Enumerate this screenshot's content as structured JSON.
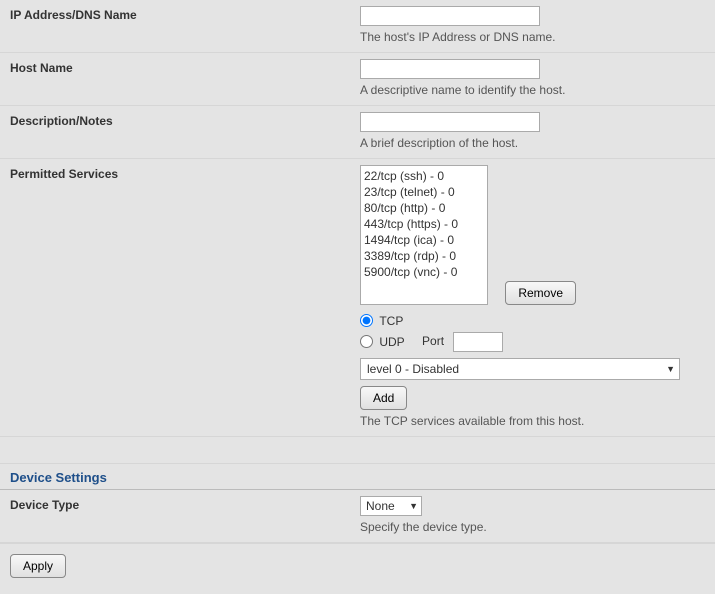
{
  "fields": {
    "ip": {
      "label": "IP Address/DNS Name",
      "value": "",
      "helper": "The host's IP Address or DNS name."
    },
    "hostname": {
      "label": "Host Name",
      "value": "",
      "helper": "A descriptive name to identify the host."
    },
    "description": {
      "label": "Description/Notes",
      "value": "",
      "helper": "A brief description of the host."
    },
    "services": {
      "label": "Permitted Services",
      "list": [
        "22/tcp (ssh) - 0",
        "23/tcp (telnet) - 0",
        "80/tcp (http) - 0",
        "443/tcp (https) - 0",
        "1494/tcp (ica) - 0",
        "3389/tcp (rdp) - 0",
        "5900/tcp (vnc) - 0"
      ],
      "remove_label": "Remove",
      "tcp_label": "TCP",
      "udp_label": "UDP",
      "port_label": "Port",
      "port_value": "",
      "level_selected": "level 0 - Disabled",
      "add_label": "Add",
      "helper": "The TCP services available from this host."
    }
  },
  "device_section": {
    "header": "Device Settings",
    "type_label": "Device Type",
    "type_selected": "None",
    "helper": "Specify the device type."
  },
  "apply_label": "Apply"
}
